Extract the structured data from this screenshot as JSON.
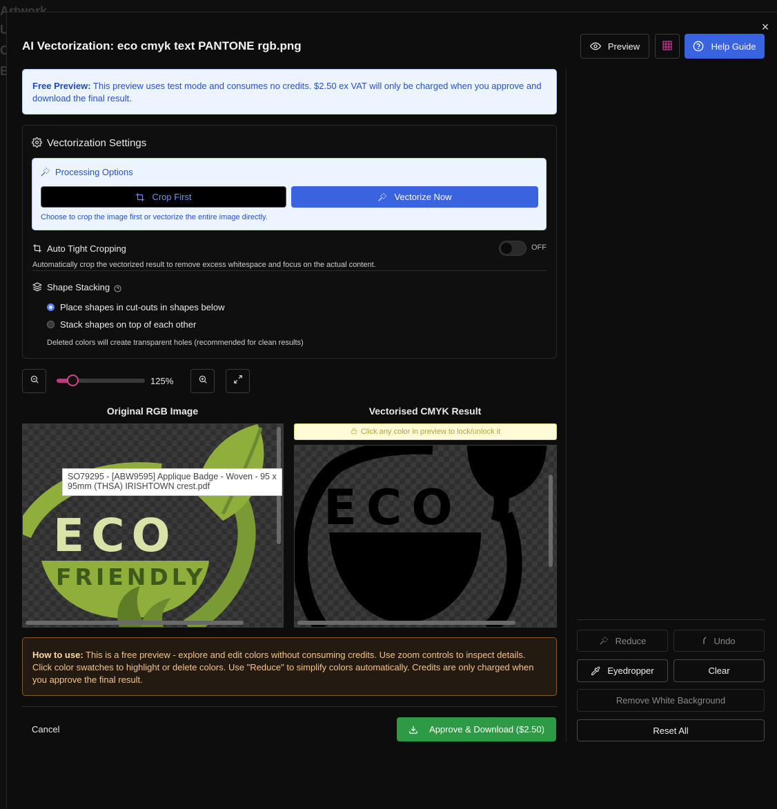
{
  "background": {
    "partial_title": "Artwork",
    "letters": [
      "U",
      "C",
      "B"
    ]
  },
  "dialog": {
    "title": "AI Vectorization: eco cmyk text PANTONE rgb.png",
    "close_label": "×"
  },
  "header": {
    "preview_label": "Preview",
    "help_label": "Help Guide"
  },
  "notice": {
    "bold": "Free Preview:",
    "text": " This preview uses test mode and consumes no credits. $2.50 ex VAT will only be charged when you approve and download the final result."
  },
  "settings": {
    "title": "Vectorization Settings",
    "processing": {
      "title": "Processing Options",
      "crop_label": "Crop First",
      "vectorize_label": "Vectorize Now",
      "hint": "Choose to crop the image first or vectorize the entire image directly."
    },
    "auto_crop": {
      "title": "Auto Tight Cropping",
      "toggle_state": "OFF",
      "description": "Automatically crop the vectorized result to remove excess whitespace and focus on the actual content."
    },
    "stacking": {
      "title": "Shape Stacking",
      "options": [
        "Place shapes in cut-outs in shapes below",
        "Stack shapes on top of each other"
      ],
      "selected_index": 0,
      "description": "Deleted colors will create transparent holes (recommended for clean results)"
    }
  },
  "zoom": {
    "level_text": "125%",
    "slider_fraction": 0.18
  },
  "preview": {
    "original_title": "Original RGB Image",
    "result_title": "Vectorised CMYK Result",
    "lock_hint": "Click any color in preview to lock/unlock it",
    "logo_word1": "ECO",
    "logo_word2": "FRIENDLY",
    "tooltip": "SO79295 - [ABW9595] Applique Badge - Woven - 95 x 95mm (THSA) IRISHTOWN crest.pdf"
  },
  "howto": {
    "bold": "How to use:",
    "text": " This is a free preview - explore and edit colors without consuming credits. Use zoom controls to inspect details. Click color swatches to highlight or delete colors. Use \"Reduce\" to simplify colors automatically. Credits are only charged when you approve the final result."
  },
  "footer": {
    "cancel_label": "Cancel",
    "approve_label": "Approve & Download ($2.50)"
  },
  "sidebar": {
    "reduce_label": "Reduce",
    "undo_label": "Undo",
    "eyedropper_label": "Eyedropper",
    "clear_label": "Clear",
    "remove_bg_label": "Remove White Background",
    "reset_label": "Reset All"
  },
  "colors": {
    "accent_blue": "#3a63e0",
    "green": "#2f9a45",
    "logo_green": "#8fae3c",
    "logo_cream": "#d9e3a8"
  }
}
